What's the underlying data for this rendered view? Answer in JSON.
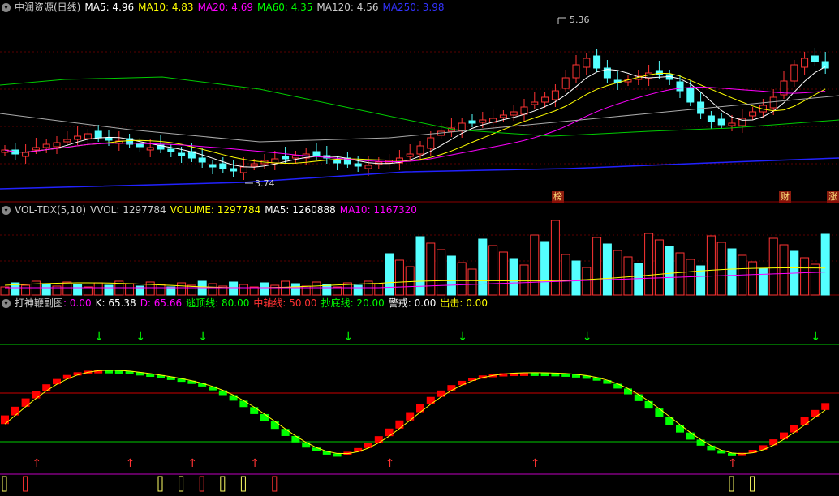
{
  "price_header": {
    "title": "中润资源(日线)",
    "indicators": [
      {
        "label": "MA5: 4.96",
        "color": "#ffffff"
      },
      {
        "label": "MA10: 4.83",
        "color": "#ffff00"
      },
      {
        "label": "MA20: 4.69",
        "color": "#ff00ff"
      },
      {
        "label": "MA60: 4.35",
        "color": "#00ff00"
      },
      {
        "label": "MA120: 4.56",
        "color": "#cccccc"
      },
      {
        "label": "MA250: 3.98",
        "color": "#3333ff"
      }
    ]
  },
  "annotations": {
    "high": "5.36",
    "low": "3.74"
  },
  "tags": [
    "榜",
    "财",
    "涨"
  ],
  "vol_header": {
    "title": "VOL-TDX(5,10)",
    "indicators": [
      {
        "label": "VVOL: 1297784",
        "color": "#cccccc"
      },
      {
        "label": "VOLUME: 1297784",
        "color": "#ffff00"
      },
      {
        "label": "MA5: 1260888",
        "color": "#ffffff"
      },
      {
        "label": "MA10: 1167320",
        "color": "#ff00ff"
      }
    ]
  },
  "kd_header": {
    "title": "打神鞭副图",
    "indicators": [
      {
        "label": ": 0.00",
        "color": "#ff00ff"
      },
      {
        "label": "K: 65.38",
        "color": "#ffffff"
      },
      {
        "label": "D: 65.66",
        "color": "#ff00ff"
      },
      {
        "label": "逃顶线: 80.00",
        "color": "#00ff00"
      },
      {
        "label": "中轴线: 50.00",
        "color": "#ff3333"
      },
      {
        "label": "抄底线: 20.00",
        "color": "#00ff00"
      },
      {
        "label": "警戒: 0.00",
        "color": "#ffffff"
      },
      {
        "label": "出击: 0.00",
        "color": "#ffff00"
      }
    ]
  },
  "colors": {
    "up": "#ff3333",
    "down": "#54ffff",
    "kd_up": "#ff0000",
    "kd_down": "#00ff00",
    "ma250": "#2222ff",
    "ma60": "#00cc00"
  }
}
